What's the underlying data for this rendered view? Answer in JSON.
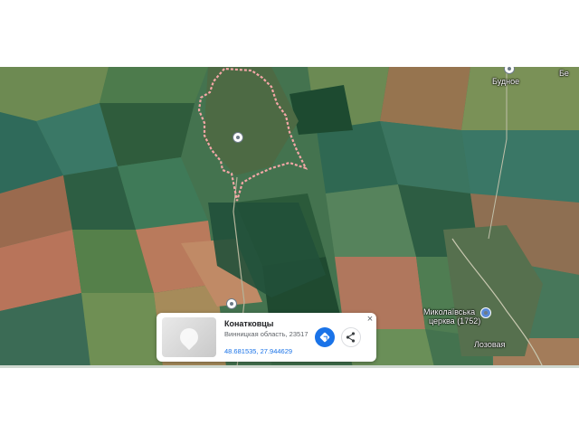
{
  "map": {
    "type": "satellite",
    "places": {
      "konatkovtsy": {
        "icon": "location-pin-icon"
      },
      "budnoe": {
        "label": "Будное",
        "icon": "location-pin-icon"
      },
      "church": {
        "label_line1": "Миколаївська",
        "label_line2": "церква (1752)",
        "icon": "church-pin-icon"
      },
      "lozovaya": {
        "label": "Лозовая"
      },
      "corner": {
        "label": "Бе"
      },
      "dropped_pin": {
        "icon": "dropped-pin-icon"
      }
    },
    "boundary_color": "#f4a6a6"
  },
  "card": {
    "title": "Конатковцы",
    "address": "Винницкая область, 23517",
    "coordinates": "48.681535, 27.944629",
    "directions_icon": "directions-icon",
    "share_icon": "share-icon",
    "close_icon": "close-icon",
    "close_glyph": "×",
    "accent": "#1a73e8"
  }
}
